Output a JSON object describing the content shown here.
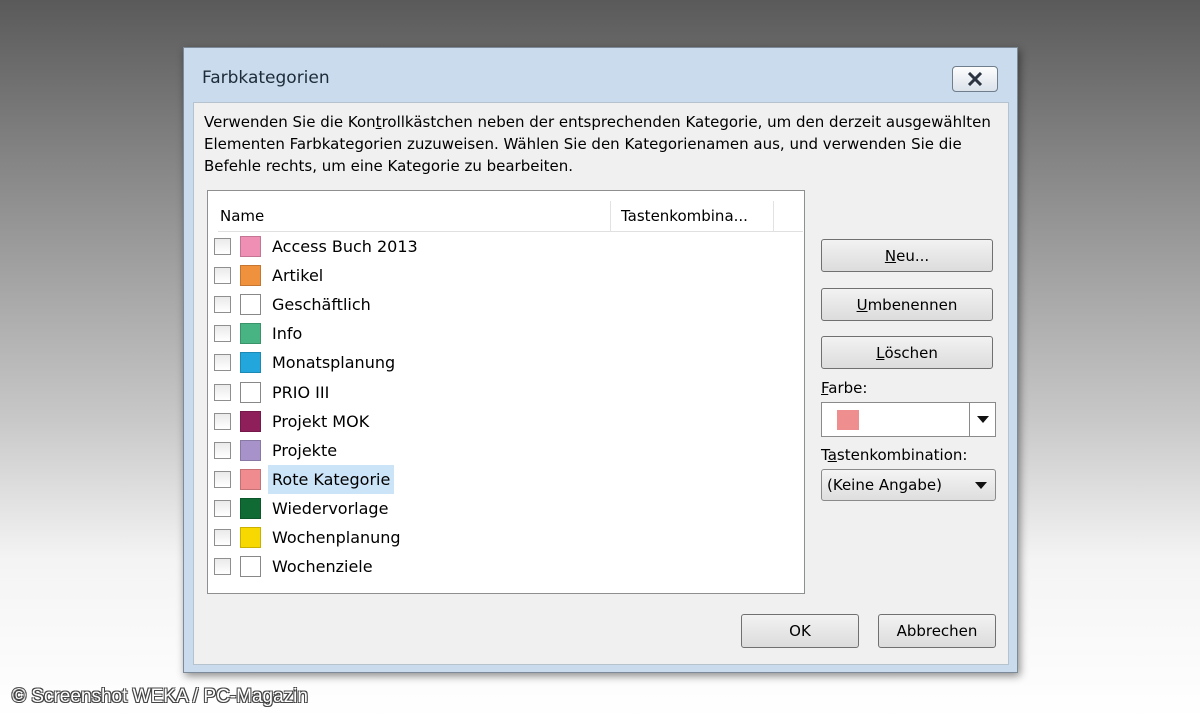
{
  "dialog": {
    "title": "Farbkategorien",
    "instruction": "Verwenden Sie die Kontrollkästchen neben der entsprechenden Kategorie, um den derzeit ausgewählten Elementen Farbkategorien zuzuweisen. Wählen Sie den Kategorienamen aus, und verwenden Sie die Befehle rechts, um eine Kategorie zu bearbeiten."
  },
  "list": {
    "headers": {
      "name": "Name",
      "shortcut": "Tastenkombina..."
    },
    "items": [
      {
        "label": "Access Buch 2013",
        "color": "#ef8fb4",
        "checked": false
      },
      {
        "label": "Artikel",
        "color": "#f0913e",
        "checked": false
      },
      {
        "label": "Geschäftlich",
        "color": "",
        "checked": false
      },
      {
        "label": "Info",
        "color": "#49b483",
        "checked": false
      },
      {
        "label": "Monatsplanung",
        "color": "#23a6dc",
        "checked": false
      },
      {
        "label": "PRIO III",
        "color": "",
        "checked": false
      },
      {
        "label": "Projekt MOK",
        "color": "#8e1f5b",
        "checked": false
      },
      {
        "label": "Projekte",
        "color": "#a793c9",
        "checked": false
      },
      {
        "label": "Rote Kategorie",
        "color": "#f08c8f",
        "checked": false,
        "selected": true
      },
      {
        "label": "Wiedervorlage",
        "color": "#0f6b33",
        "checked": false
      },
      {
        "label": "Wochenplanung",
        "color": "#f7d800",
        "checked": false
      },
      {
        "label": "Wochenziele",
        "color": "",
        "checked": false
      }
    ]
  },
  "buttons": {
    "new": {
      "pre": "",
      "acc": "N",
      "post": "eu..."
    },
    "rename": {
      "pre": "",
      "acc": "U",
      "post": "mbenennen"
    },
    "delete": {
      "pre": "",
      "acc": "L",
      "post": "öschen"
    },
    "ok": "OK",
    "cancel": "Abbrechen"
  },
  "color_field": {
    "label_acc": "F",
    "label_rest": "arbe:",
    "selected_color": "#ef8e8f"
  },
  "shortcut_field": {
    "label_pre": "T",
    "label_acc": "a",
    "label_rest": "stenkombination:",
    "value": "(Keine Angabe)"
  },
  "instruction_parts": {
    "pre": "Verwenden Sie die Kon",
    "acc": "t",
    "post": "rollkästchen neben der entsprechenden Kategorie, um den derzeit ausgewählten Elementen Farbkategorien zuzuweisen. Wählen Sie den Kategorienamen aus, und verwenden Sie die Befehle rechts, um eine Kategorie zu bearbeiten."
  },
  "watermark": "© Screenshot WEKA / PC-Magazin"
}
